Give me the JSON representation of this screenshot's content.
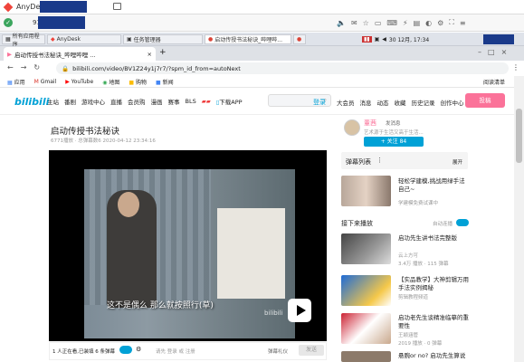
{
  "anydesk": {
    "title": "AnyDesk",
    "address_prefix": "91"
  },
  "taskbar": {
    "items": [
      {
        "label": "所有应用程序"
      },
      {
        "label": "AnyDesk"
      },
      {
        "label": "任务管理器"
      },
      {
        "label": "启动传授书法秘诀_哔哩哔..."
      }
    ],
    "clock": "30 12月, 17:34"
  },
  "browser": {
    "tab_title": "启动传授书法秘诀_哔哩哔哩 ...",
    "url": "bilibili.com/video/BV1Z24y1j7r7/?spm_id_from=autoNext",
    "bookmarks": [
      "应用",
      "Gmail",
      "YouTube",
      "地图",
      "购物",
      "新闻"
    ],
    "reading_list": "阅读清单"
  },
  "bili_nav": {
    "logo": "bilibili",
    "links": [
      "主站",
      "番剧",
      "游戏中心",
      "直播",
      "会员购",
      "漫画",
      "赛事",
      "BLS",
      "下载APP"
    ],
    "right_links": [
      "大会员",
      "消息",
      "动态",
      "收藏",
      "历史记录",
      "创作中心"
    ],
    "login": "登录",
    "upload": "投稿",
    "search_placeholder": ""
  },
  "video": {
    "title": "启动传授书法秘诀",
    "meta": "6771播放 · 总弹幕数6    2020-04-12 23:34:16",
    "subtitle": "这不是偶么    那么就按照行(草)",
    "watermark": "bilibili",
    "online": "1 人正在看,已装填 6 条弹幕",
    "danmu_hint": "请先 登录 或 注册",
    "danmu_settings": "弹幕礼仪",
    "send": "发送"
  },
  "uploader": {
    "name": "董茜",
    "message": "发消息",
    "desc": "艺术源于生活又高于生活...",
    "follow": "+ 关注 84"
  },
  "sidebar": {
    "danmaku_list": "弹幕列表",
    "expand": "展开",
    "ad_title": "轻松学建模,挑战用绿手法自己~",
    "ad_meta": "学建模免费试课中",
    "up_next": "接下来播放",
    "autoplay": "自动连播",
    "recs": [
      {
        "title": "启功先生讲书法完整版",
        "author": "云上方可",
        "meta": "3.4万 播放 · 115 弹幕"
      },
      {
        "title": "【实品教学】大神剪辑万用手法实例揭秘",
        "author": "剪辑教程频道",
        "meta": ""
      },
      {
        "title": "启功老先生谈精准临摹的重要性",
        "author": "王颖涵管",
        "meta": "2019 播放 · 0 弹幕"
      },
      {
        "title": "悬腕or no? 启功先生算说",
        "author": "",
        "meta": ""
      }
    ]
  },
  "colors": {
    "bili_blue": "#00a1d6",
    "bili_pink": "#fb7299",
    "anydesk_red": "#ef443b"
  }
}
